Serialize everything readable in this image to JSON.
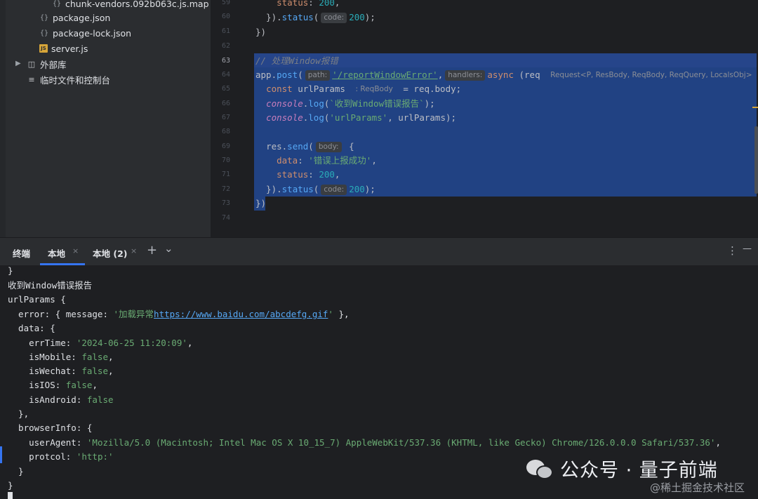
{
  "project_tree": {
    "items": [
      {
        "label": "chunk-vendors.092b063c.js.map",
        "icon": "json-braces-icon"
      },
      {
        "label": "package.json",
        "icon": "json-braces-icon"
      },
      {
        "label": "package-lock.json",
        "icon": "json-braces-icon"
      },
      {
        "label": "server.js",
        "icon": "js-file-icon"
      },
      {
        "label": "外部库",
        "icon": "library-icon"
      },
      {
        "label": "临时文件和控制台",
        "icon": "scratch-icon"
      }
    ],
    "js_badge": "JS"
  },
  "editor": {
    "line_numbers": [
      "59",
      "60",
      "61",
      "62",
      "63",
      "64",
      "65",
      "66",
      "67",
      "68",
      "69",
      "70",
      "71",
      "72",
      "73",
      "74"
    ],
    "current_line": "63",
    "lines": {
      "l59": {
        "indent": "    ",
        "key": "status",
        "colon": ": ",
        "num": "200",
        "tail": ","
      },
      "l60": {
        "pre": "  }).",
        "fn": "status",
        "open": "(",
        "hint": "code:",
        "num": "200",
        "close": ");"
      },
      "l61": {
        "text": "})"
      },
      "l63": {
        "comment": "// 处理Window报错"
      },
      "l64": {
        "obj": "app.",
        "fn": "post",
        "open": "(",
        "hint_path": "path:",
        "route": "'/reportWindowError'",
        "comma": ",",
        "hint_handlers": "handlers:",
        "async": "async",
        "rest": " (req ",
        "hint_type": "Request<P, ResBody, ReqBody, ReqQuery, LocalsObj>"
      },
      "l65": {
        "indent": "  ",
        "kw": "const",
        "var": " urlParams ",
        "hint": ": ReqBody",
        "rest": " = req.body;"
      },
      "l66": {
        "indent": "  ",
        "obj": "console",
        "dot": ".",
        "fn": "log",
        "open": "(",
        "str": "`收到Window错误报告`",
        "close": ");"
      },
      "l67": {
        "indent": "  ",
        "obj": "console",
        "dot": ".",
        "fn": "log",
        "open": "(",
        "str": "'urlParams'",
        "close": ", urlParams);"
      },
      "l69": {
        "indent": "  ",
        "pre": "res.",
        "fn": "send",
        "open": "(",
        "hint": "body:",
        "close": " {"
      },
      "l70": {
        "indent": "    ",
        "key": "data",
        "colon": ": ",
        "str": "'错误上报成功'",
        "tail": ","
      },
      "l71": {
        "indent": "    ",
        "key": "status",
        "colon": ": ",
        "num": "200",
        "tail": ","
      },
      "l72": {
        "pre": "  }).",
        "fn": "status",
        "open": "(",
        "hint": "code:",
        "num": "200",
        "close": ");"
      },
      "l73": {
        "text": "})"
      }
    }
  },
  "terminal_header": {
    "title": "终端",
    "tab_active": "本地",
    "tab_second": "本地 (2)",
    "close_glyph": "×",
    "add_glyph": "+",
    "dropdown_glyph": "⌄",
    "more_glyph": "⋮",
    "minimize_glyph": "—"
  },
  "terminal": {
    "l0": "}",
    "l1": "收到Window错误报告",
    "l2": "urlParams {",
    "l3": {
      "pre": "  error: { message: ",
      "q1": "'加载异常",
      "link": "https://www.baidu.com/abcdefg.gif",
      "q2": "'",
      "post": " },"
    },
    "l4": "  data: {",
    "l5": {
      "pre": "    errTime: ",
      "val": "'2024-06-25 11:20:09'",
      "post": ","
    },
    "l6": {
      "pre": "    isMobile: ",
      "val": "false",
      "post": ","
    },
    "l7": {
      "pre": "    isWechat: ",
      "val": "false",
      "post": ","
    },
    "l8": {
      "pre": "    isIOS: ",
      "val": "false",
      "post": ","
    },
    "l9": {
      "pre": "    isAndroid: ",
      "val": "false",
      "post": ""
    },
    "l10": "  },",
    "l11": "  browserInfo: {",
    "l12": {
      "pre": "    userAgent: ",
      "val": "'Mozilla/5.0 (Macintosh; Intel Mac OS X 10_15_7) AppleWebKit/537.36 (KHTML, like Gecko) Chrome/126.0.0.0 Safari/537.36'",
      "post": ","
    },
    "l13": {
      "pre": "    protcol: ",
      "val": "'http:'",
      "post": ""
    },
    "l14": "  }",
    "l15": "}"
  },
  "watermark": {
    "main": "公众号 · 量子前端",
    "sub": "@稀土掘金技术社区"
  },
  "colors": {
    "selection": "#214283",
    "accent": "#3574f0",
    "string": "#6aab73",
    "keyword": "#cf8e6d",
    "function": "#56a8f5",
    "number": "#2aacb8"
  }
}
